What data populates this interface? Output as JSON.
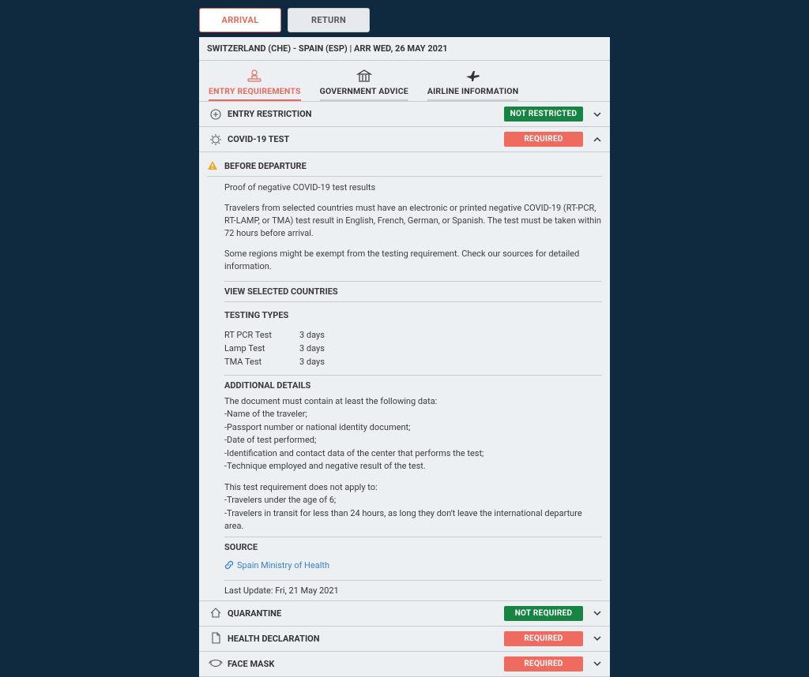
{
  "topTabs": {
    "arrival": "ARRIVAL",
    "return": "RETURN"
  },
  "route": "SWITZERLAND (CHE) - SPAIN (ESP) | ARR WED, 26 MAY 2021",
  "subTabs": {
    "entry": "ENTRY REQUIREMENTS",
    "gov": "GOVERNMENT ADVICE",
    "airline": "AIRLINE INFORMATION"
  },
  "rows": {
    "entryRestriction": {
      "title": "ENTRY RESTRICTION",
      "badge": "NOT RESTRICTED"
    },
    "covidTest": {
      "title": "COVID-19 TEST",
      "badge": "REQUIRED"
    },
    "quarantine": {
      "title": "QUARANTINE",
      "badge": "NOT REQUIRED"
    },
    "healthDecl": {
      "title": "HEALTH DECLARATION",
      "badge": "REQUIRED"
    },
    "faceMask": {
      "title": "FACE MASK",
      "badge": "REQUIRED"
    }
  },
  "covid": {
    "beforeDeparture": "BEFORE DEPARTURE",
    "proof": "Proof of negative COVID-19 test results",
    "para1": "Travelers from selected countries must have an electronic or printed negative COVID-19 (RT-PCR, RT-LAMP, or TMA) test result in English, French, German, or Spanish. The test must be taken within 72 hours before arrival.",
    "para2": "Some regions might be exempt from the testing requirement. Check our sources for detailed information.",
    "viewCountries": "VIEW SELECTED COUNTRIES",
    "testingTypesHdr": "TESTING TYPES",
    "tests": [
      {
        "name": "RT PCR Test",
        "duration": "3 days"
      },
      {
        "name": "Lamp Test",
        "duration": "3 days"
      },
      {
        "name": "TMA Test",
        "duration": "3 days"
      }
    ],
    "additionalHdr": "ADDITIONAL DETAILS",
    "details1": [
      "The document must contain at least the following data:",
      "-Name of the traveler;",
      "-Passport number or national identity document;",
      "-Date of test performed;",
      "-Identification and contact data of the center that performs the test;",
      "-Technique employed and negative result of the test."
    ],
    "details2": [
      "This test requirement does not apply to:",
      "-Travelers under the age of 6;",
      "-Travelers in transit for less than 24 hours, as long they don't leave the international departure area."
    ],
    "sourceHdr": "SOURCE",
    "sourceLink": "Spain Ministry of Health",
    "lastUpdate": "Last Update: Fri, 21 May 2021"
  }
}
